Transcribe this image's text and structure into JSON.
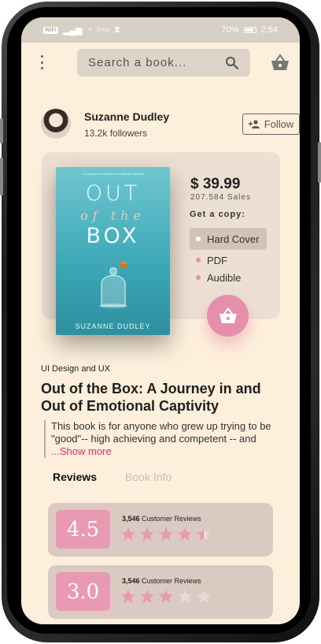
{
  "status_bar": {
    "carrier": "WiFi",
    "speed": "0 K/s",
    "battery": "70%",
    "time": "2:54"
  },
  "search": {
    "placeholder": "Search a book..."
  },
  "author": {
    "name": "Suzanne Dudley",
    "followers": "13.2k followers",
    "follow_label": "Follow"
  },
  "book": {
    "cover_subtitle": "A Journey In and Out of Emotional Captivity",
    "cover_title_line1": "OUT",
    "cover_title_line2": "of the",
    "cover_title_line3": "BOX",
    "cover_author": "SUZANNE DUDLEY",
    "price": "$ 39.99",
    "sales": "207.584 Sales",
    "get_copy": "Get a copy:",
    "formats": [
      "Hard Cover",
      "PDF",
      "Audible"
    ],
    "selected_format": "Hard Cover",
    "category": "UI Design and UX",
    "title": "Out of the Box: A Journey in and Out of Emotional Captivity",
    "description": "This book is for anyone who grew up trying to be \"good\"-- high achieving and competent -- and",
    "show_more": "...Show more"
  },
  "tabs": [
    "Reviews",
    "Book Info"
  ],
  "active_tab": "Reviews",
  "reviews": [
    {
      "score": "4.5",
      "count": "3,546",
      "label": "Customer Reviews",
      "stars": 4.5
    },
    {
      "score": "3.0",
      "count": "3,546",
      "label": "Customer Reviews",
      "stars": 3
    }
  ],
  "colors": {
    "background": "#fdefdb",
    "accent_pink": "#e58fab",
    "card": "#ece0d3"
  }
}
